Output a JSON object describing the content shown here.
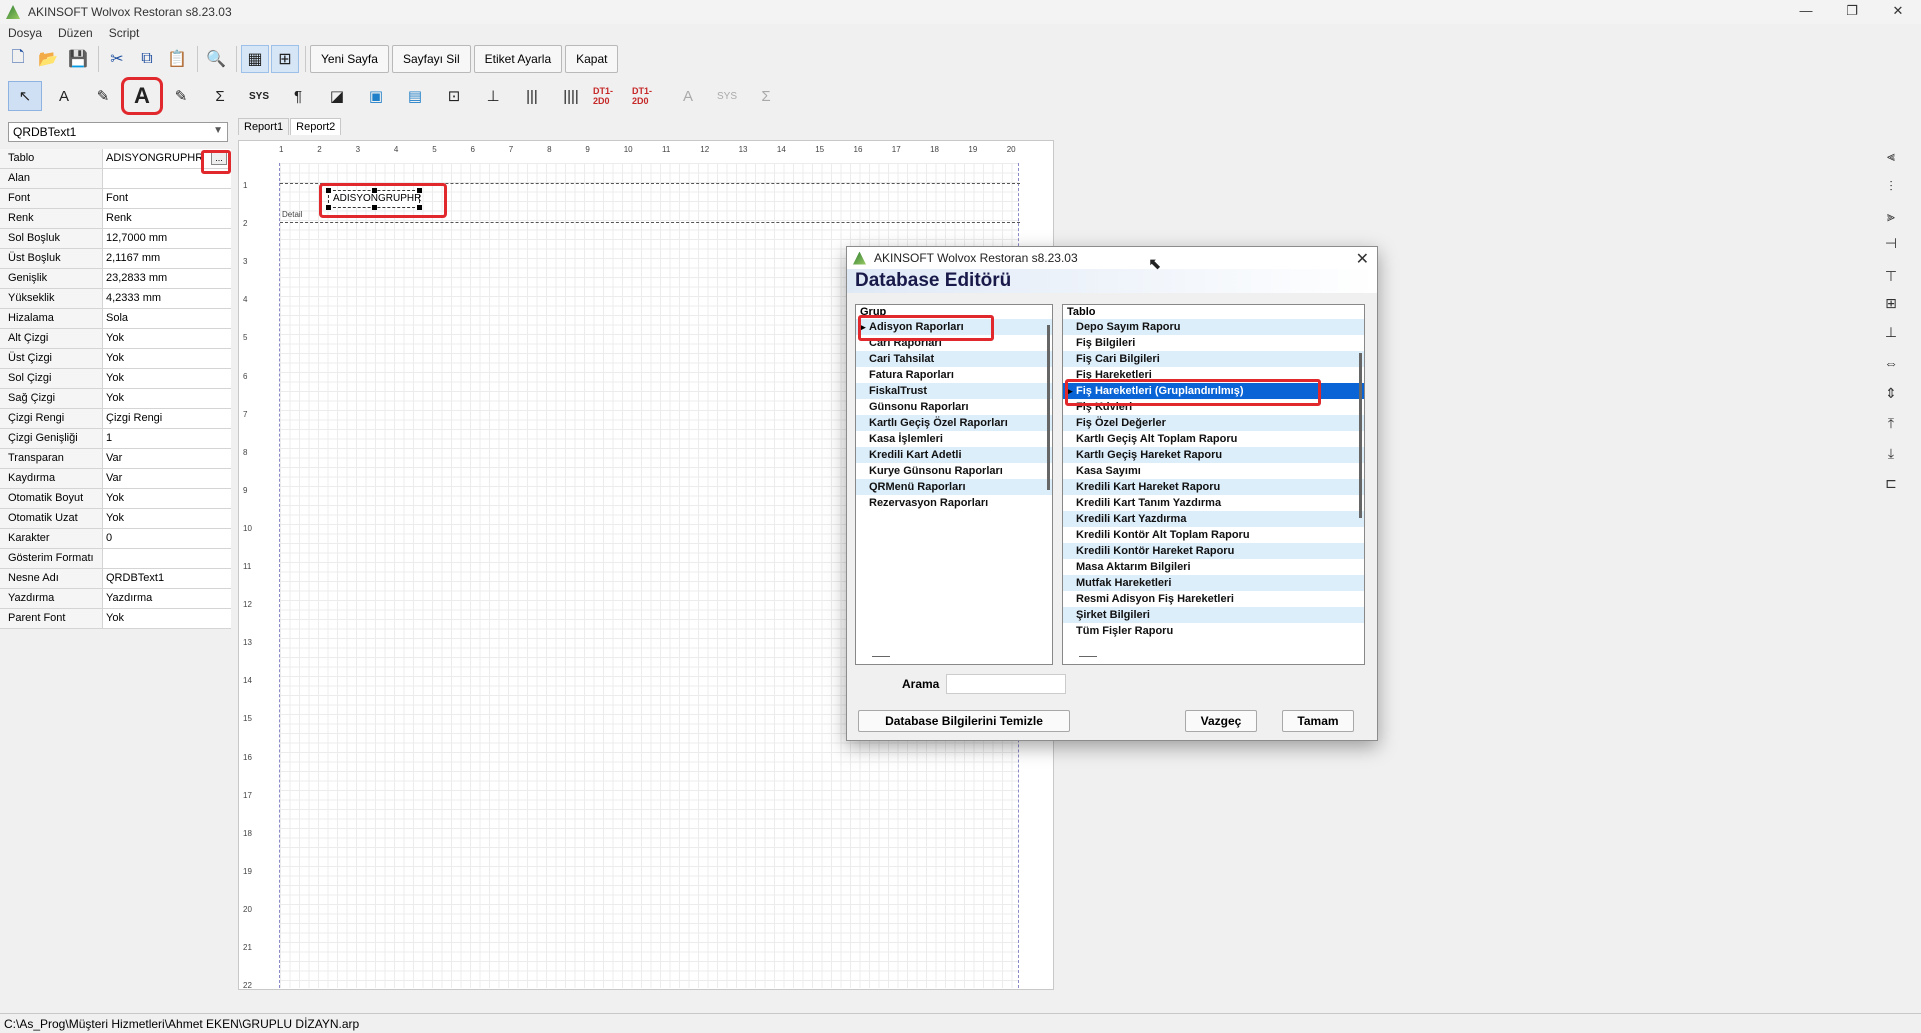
{
  "window": {
    "title": "AKINSOFT Wolvox Restoran s8.23.03",
    "min": "—",
    "max": "❐",
    "close": "✕"
  },
  "menu": [
    "Dosya",
    "Düzen",
    "Script"
  ],
  "toolbar": {
    "new_page": "Yeni Sayfa",
    "delete_page": "Sayfayı Sil",
    "label_settings": "Etiket Ayarla",
    "close": "Kapat"
  },
  "toolbar2_labels": {
    "sys": "SYS",
    "barcode": "DT1-2D0"
  },
  "object_selector": "QRDBText1",
  "properties": [
    {
      "name": "Tablo",
      "value": "ADISYONGRUPHR"
    },
    {
      "name": "Alan",
      "value": ""
    },
    {
      "name": "Font",
      "value": "Font"
    },
    {
      "name": "Renk",
      "value": "Renk"
    },
    {
      "name": "Sol Boşluk",
      "value": "12,7000 mm"
    },
    {
      "name": "Üst Boşluk",
      "value": "2,1167 mm"
    },
    {
      "name": "Genişlik",
      "value": "23,2833 mm"
    },
    {
      "name": "Yükseklik",
      "value": "4,2333 mm"
    },
    {
      "name": "Hizalama",
      "value": "Sola"
    },
    {
      "name": "Alt Çizgi",
      "value": "Yok"
    },
    {
      "name": "Üst Çizgi",
      "value": "Yok"
    },
    {
      "name": "Sol Çizgi",
      "value": "Yok"
    },
    {
      "name": "Sağ Çizgi",
      "value": "Yok"
    },
    {
      "name": "Çizgi Rengi",
      "value": "Çizgi Rengi"
    },
    {
      "name": "Çizgi Genişliği",
      "value": "1"
    },
    {
      "name": "Transparan",
      "value": "Var"
    },
    {
      "name": "Kaydırma",
      "value": "Var"
    },
    {
      "name": "Otomatik Boyut",
      "value": "Yok"
    },
    {
      "name": "Otomatik Uzat",
      "value": "Yok"
    },
    {
      "name": "Karakter",
      "value": "0"
    },
    {
      "name": "Gösterim Formatı",
      "value": ""
    },
    {
      "name": "Nesne Adı",
      "value": "QRDBText1"
    },
    {
      "name": "Yazdırma",
      "value": "Yazdırma"
    },
    {
      "name": "Parent Font",
      "value": "Yok"
    }
  ],
  "tabs": [
    "Report1",
    "Report2"
  ],
  "designer": {
    "ruler_h": [
      "1",
      "2",
      "3",
      "4",
      "5",
      "6",
      "7",
      "8",
      "9",
      "10",
      "11",
      "12",
      "13",
      "14",
      "15",
      "16",
      "17",
      "18",
      "19",
      "20"
    ],
    "ruler_v": [
      "1",
      "2",
      "3",
      "4",
      "5",
      "6",
      "7",
      "8",
      "9",
      "10",
      "11",
      "12",
      "13",
      "14",
      "15",
      "16",
      "17",
      "18",
      "19",
      "20",
      "21",
      "22"
    ],
    "band_label": "Detail",
    "field_text": "ADISYONGRUPHR"
  },
  "status_path": "C:\\As_Prog\\Müşteri Hizmetleri\\Ahmet EKEN\\GRUPLU DİZAYN.arp",
  "dialog": {
    "title": "AKINSOFT Wolvox Restoran s8.23.03",
    "header": "Database Editörü",
    "group_header": "Grup",
    "groups": [
      "Adisyon Raporları",
      "Cari Raporları",
      "Cari Tahsilat",
      "Fatura Raporları",
      "FiskalTrust",
      "Günsonu Raporları",
      "Kartlı Geçiş Özel Raporları",
      "Kasa İşlemleri",
      "Kredili Kart Adetli",
      "Kurye Günsonu Raporları",
      "QRMenü Raporları",
      "Rezervasyon Raporları"
    ],
    "table_header": "Tablo",
    "tables": [
      "Depo Sayım Raporu",
      "Fiş Bilgileri",
      "Fiş Cari Bilgileri",
      "Fiş Hareketleri",
      "Fiş Hareketleri (Gruplandırılmış)",
      "Fiş Kdvleri",
      "Fiş Özel Değerler",
      "Kartlı Geçiş Alt Toplam Raporu",
      "Kartlı Geçiş Hareket Raporu",
      "Kasa Sayımı",
      "Kredili Kart Hareket Raporu",
      "Kredili Kart Tanım Yazdırma",
      "Kredili Kart Yazdırma",
      "Kredili Kontör Alt Toplam Raporu",
      "Kredili Kontör Hareket Raporu",
      "Masa Aktarım Bilgileri",
      "Mutfak Hareketleri",
      "Resmi Adisyon Fiş Hareketleri",
      "Şirket Bilgileri",
      "Tüm Fişler Raporu"
    ],
    "search_label": "Arama",
    "search_value": "",
    "clear_button": "Database Bilgilerini Temizle",
    "cancel_button": "Vazgeç",
    "ok_button": "Tamam"
  }
}
